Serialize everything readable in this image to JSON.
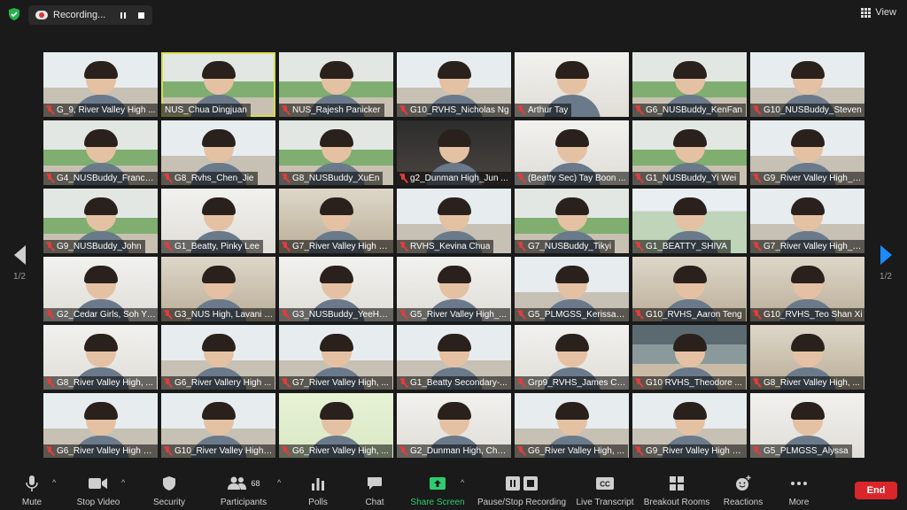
{
  "topbar": {
    "recording_label": "Recording...",
    "view_label": "View"
  },
  "pagination": {
    "left": "1/2",
    "right": "1/2"
  },
  "participants": [
    "G_9, River Valley High ...",
    "NUS_Chua Dingjuan",
    "NUS_Rajesh Panicker",
    "G10_RVHS_Nicholas Ng",
    "Arthur Tay",
    "G6_NUSBuddy_KenFan",
    "G10_NUSBuddy_Steven",
    "G4_NUSBuddy_France...",
    "G8_Rvhs_Chen_Jie",
    "G8_NUSBuddy_XuEn",
    "g2_Dunman High_Jun ...",
    "(Beatty Sec) Tay Boon ...",
    "G1_NUSBuddy_Yi Wei",
    "G9_River Valley High_L...",
    "G9_NUSBuddy_John",
    "G1_Beatty, Pinky Lee",
    "G7_River Valley High S...",
    "RVHS_Kevina Chua",
    "G7_NUSBuddy_Tikyi",
    "G1_BEATTY_SHIVA",
    "G7_River Valley High_L...",
    "G2_Cedar Girls, Soh Yi ...",
    "G3_NUS High, Lavani S...",
    "G3_NUSBuddy_YeeHsien",
    "G5_River Valley High_...",
    "G5_PLMGSS_Kerissa Lim",
    "G10_RVHS_Aaron Teng",
    "G10_RVHS_Teo Shan Xi",
    "G8_River Valley High, ...",
    "G6_River Vallery High ...",
    "G7_River Valley High, ...",
    "G1_Beatty Secondary-...",
    "Grp9_RVHS_James Chan",
    "G10 RVHS_Theodore ...",
    "G8_River Valley High, ...",
    "G6_River Valley High S...",
    "G10_River Valley High_...",
    "G6_River Valley High, ...",
    "G2_Dunman High, Chu...",
    "G6_River Valley High, ...",
    "G9_River Valley High S...",
    "G5_PLMGSS_Alyssa"
  ],
  "toolbar": {
    "mute": "Mute",
    "stop_video": "Stop Video",
    "security": "Security",
    "participants": "Participants",
    "participants_count": "68",
    "polls": "Polls",
    "chat": "Chat",
    "share_screen": "Share Screen",
    "pause_stop_recording": "Pause/Stop Recording",
    "live_transcript": "Live Transcript",
    "breakout_rooms": "Breakout Rooms",
    "reactions": "Reactions",
    "more": "More",
    "end": "End"
  },
  "colors": {
    "accent": "#1a8cff",
    "end": "#d9262b",
    "share": "#2ecc71",
    "active_speaker": "#d7e04a",
    "muted": "#e23c3c"
  }
}
